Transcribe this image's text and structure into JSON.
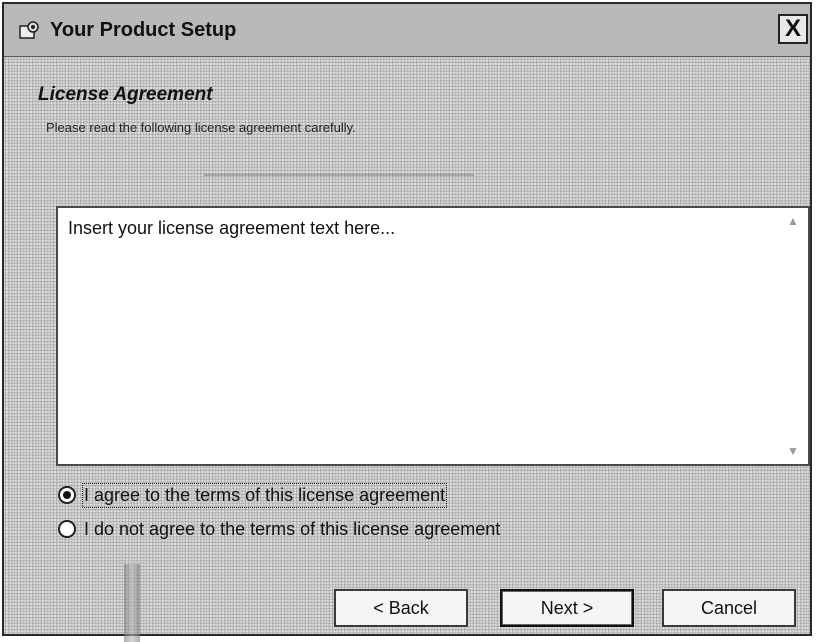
{
  "window": {
    "title": "Your Product Setup",
    "icon": "setup-icon",
    "close_symbol": "X"
  },
  "header": {
    "title": "License Agreement",
    "subtitle": "Please read the following license agreement carefully."
  },
  "license": {
    "text": "Insert your license agreement text here..."
  },
  "options": {
    "agree_label": "I agree to the terms of this license agreement",
    "disagree_label": "I do not agree to the terms of this license agreement",
    "selected": "agree"
  },
  "buttons": {
    "back": "< Back",
    "next": "Next >",
    "cancel": "Cancel"
  }
}
